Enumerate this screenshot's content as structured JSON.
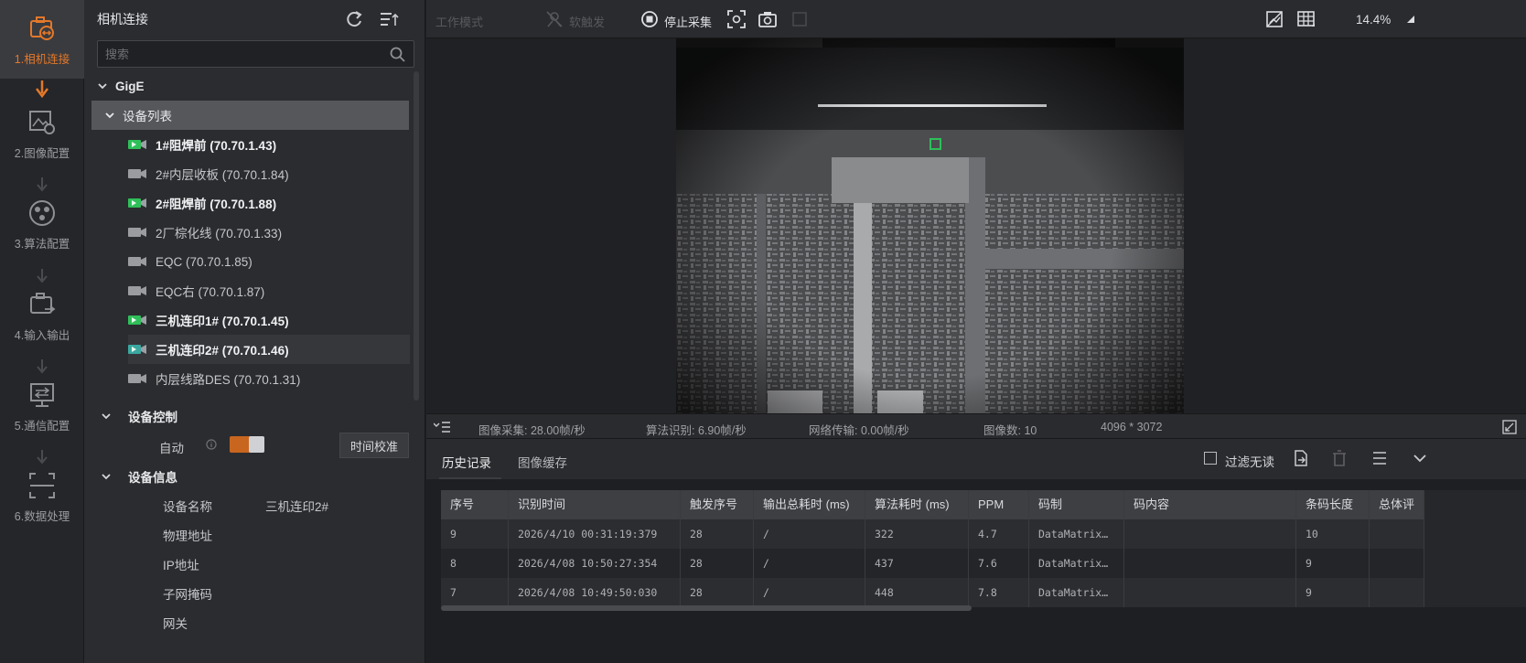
{
  "steps": [
    {
      "label": "1.相机连接",
      "icon": "camera-link-icon"
    },
    {
      "label": "2.图像配置",
      "icon": "image-settings-icon"
    },
    {
      "label": "3.算法配置",
      "icon": "algorithm-icon"
    },
    {
      "label": "4.输入输出",
      "icon": "io-icon"
    },
    {
      "label": "5.通信配置",
      "icon": "communication-icon"
    },
    {
      "label": "6.数据处理",
      "icon": "data-processing-icon"
    }
  ],
  "panel": {
    "title": "相机连接",
    "search_placeholder": "搜索",
    "group": "GigE",
    "subgroup": "设备列表",
    "devices": [
      {
        "name": "1#阻焊前 (70.70.1.43)",
        "connected": true
      },
      {
        "name": "2#内层收板 (70.70.1.84)",
        "connected": false
      },
      {
        "name": "2#阻焊前 (70.70.1.88)",
        "connected": true
      },
      {
        "name": "2厂棕化线 (70.70.1.33)",
        "connected": false
      },
      {
        "name": "EQC (70.70.1.85)",
        "connected": false
      },
      {
        "name": "EQC右 (70.70.1.87)",
        "connected": false
      },
      {
        "name": "三机连印1# (70.70.1.45)",
        "connected": true
      },
      {
        "name": "三机连印2# (70.70.1.46)",
        "connected": true,
        "selected": true
      },
      {
        "name": "内层线路DES (70.70.1.31)",
        "connected": false
      }
    ],
    "control": {
      "title": "设备控制",
      "auto_label": "自动",
      "time_button": "时间校准"
    },
    "info": {
      "title": "设备信息",
      "rows": [
        {
          "label": "设备名称",
          "value": "三机连印2#"
        },
        {
          "label": "物理地址",
          "value": ""
        },
        {
          "label": "IP地址",
          "value": ""
        },
        {
          "label": "子网掩码",
          "value": ""
        },
        {
          "label": "网关",
          "value": ""
        }
      ]
    }
  },
  "toolbar": {
    "work_mode": "工作模式",
    "trigger": "软触发",
    "stop": "停止采集",
    "zoom": "14.4%"
  },
  "status": {
    "capture": "图像采集: 28.00帧/秒",
    "algo": "算法识别: 6.90帧/秒",
    "network": "网络传输: 0.00帧/秒",
    "count": "图像数: 10",
    "resolution": "4096 * 3072"
  },
  "bottom_tabs": {
    "history": "历史记录",
    "cache": "图像缓存",
    "filter_label": "过滤无读"
  },
  "table": {
    "headers": [
      "序号",
      "识别时间",
      "触发序号",
      "输出总耗时 (ms)",
      "算法耗时 (ms)",
      "PPM",
      "码制",
      "码内容",
      "条码长度",
      "总体评"
    ],
    "rows": [
      [
        "9",
        "2026/4/10 00:31:19:379",
        "28",
        "/",
        "322",
        "4.7",
        "DataMatrix…",
        "",
        "10",
        ""
      ],
      [
        "8",
        "2026/4/08 10:50:27:354",
        "28",
        "/",
        "437",
        "7.6",
        "DataMatrix…",
        "",
        "9",
        ""
      ],
      [
        "7",
        "2026/4/08 10:49:50:030",
        "28",
        "/",
        "448",
        "7.8",
        "DataMatrix…",
        "",
        "9",
        ""
      ]
    ]
  },
  "colors": {
    "accent": "#e3782a",
    "connected": "#2fbf5a"
  }
}
